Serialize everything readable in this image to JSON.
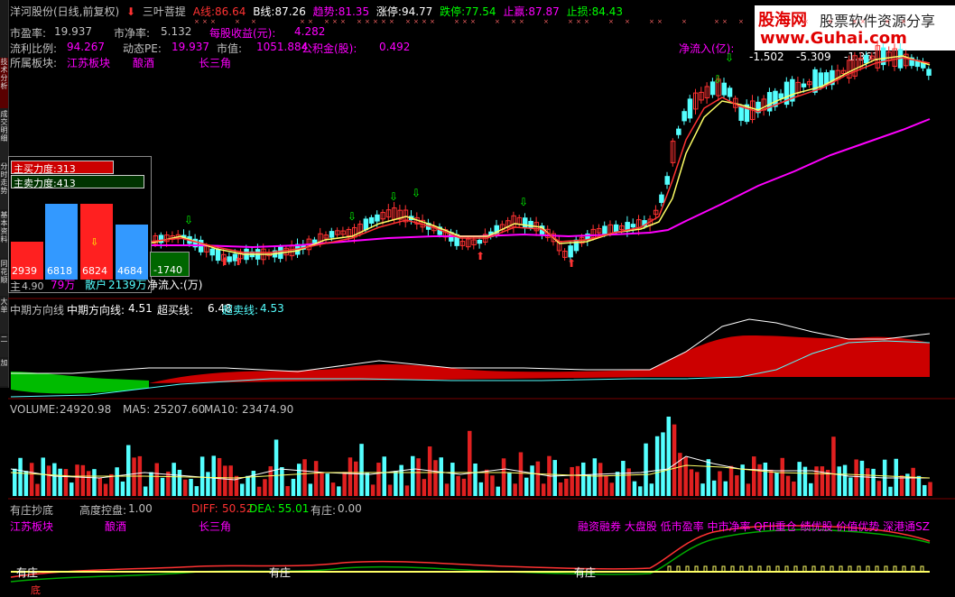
{
  "header": {
    "stock_title": "洋河股份(日线,前复权)",
    "indicator_name": "三叶菩提",
    "a_line_label": "A线:",
    "a_line_value": "86.64",
    "b_line_label": "B线:",
    "b_line_value": "87.26",
    "trend_label": "趋势:",
    "trend_value": "81.35",
    "limit_up_label": "涨停:",
    "limit_up_value": "94.77",
    "limit_down_label": "跌停:",
    "limit_down_value": "77.54",
    "take_profit_label": "止赢:",
    "take_profit_value": "87.87",
    "stop_loss_label": "止损:",
    "stop_loss_value": "84.43"
  },
  "fundamentals": {
    "pe_label": "市盈率:",
    "pe_value": "19.937",
    "pb_label": "市净率:",
    "pb_value": "5.132",
    "eps_label": "每股收益(元):",
    "eps_value": "4.282",
    "float_label": "流利比例:",
    "float_value": "94.267",
    "dyn_pe_label": "动态PE:",
    "dyn_pe_value": "19.937",
    "mkt_cap_label": "市值:",
    "mkt_cap_value": "1051.884",
    "reserve_label": "公积金(股):",
    "reserve_value": "0.492",
    "sector_label": "所属板块:",
    "sector_1": "江苏板块",
    "sector_2": "酿酒",
    "sector_3": "长三角"
  },
  "net_inflow": {
    "label": "净流入(亿):",
    "values": [
      "-1.502",
      "-5.309",
      "-1.361"
    ]
  },
  "force_panel": {
    "buy_label": "主买力度:313",
    "sell_label": "主卖力度:413",
    "bars": [
      "2939",
      "6818",
      "6824",
      "4684"
    ],
    "net_value": "-1740",
    "main_partial": "主",
    "main_value": "4.90",
    "main_wan": "79万",
    "retail_label": "散户",
    "retail_value": "2139万",
    "net_label": "净流入:(万)"
  },
  "mid_panel": {
    "title": "中期方向线",
    "line_label": "中期方向线:",
    "line_value": "4.51",
    "overbuy_label": "超买线:",
    "overbuy_value": "6.48",
    "oversell_label": "超卖线:",
    "oversell_value": "4.53"
  },
  "volume_panel": {
    "vol_label": "VOLUME:",
    "vol_value": "24920.98",
    "ma5_label": "MA5:",
    "ma5_value": "25207.60",
    "ma10_label": "MA10:",
    "ma10_value": "23474.90"
  },
  "bottom_panel": {
    "title": "有庄抄底",
    "control_label": "高度控盘:",
    "control_value": "1.00",
    "diff_label": "DIFF:",
    "diff_value": "50.52",
    "dea_label": "DEA:",
    "dea_value": "55.01",
    "dealer_label": "有庄:",
    "dealer_value": "0.00",
    "sector_1": "江苏板块",
    "sector_2": "酿酒",
    "sector_3": "长三角",
    "tags": "融资融券 大盘股 低市盈率 中市净率 QFII重仓 绩优股 价值优势 深港通SZ",
    "marker_1": "有庄",
    "marker_2": "有庄",
    "marker_3": "有庄",
    "bottom_marker": "底"
  },
  "watermark": {
    "brand": "股海网",
    "slogan": "股票软件资源分享",
    "url": "www.Guhai.com"
  },
  "sidebar_tabs": [
    "技术分析",
    "成交明细",
    "分时走势",
    "基本资料",
    "同花顺",
    "大单",
    "二",
    "加"
  ],
  "colors": {
    "up": "#ff3232",
    "down": "#54ffff",
    "yellow": "#ffff00",
    "magenta": "#ff00ff",
    "red_dark": "#cc0000",
    "green": "#00cc00"
  }
}
